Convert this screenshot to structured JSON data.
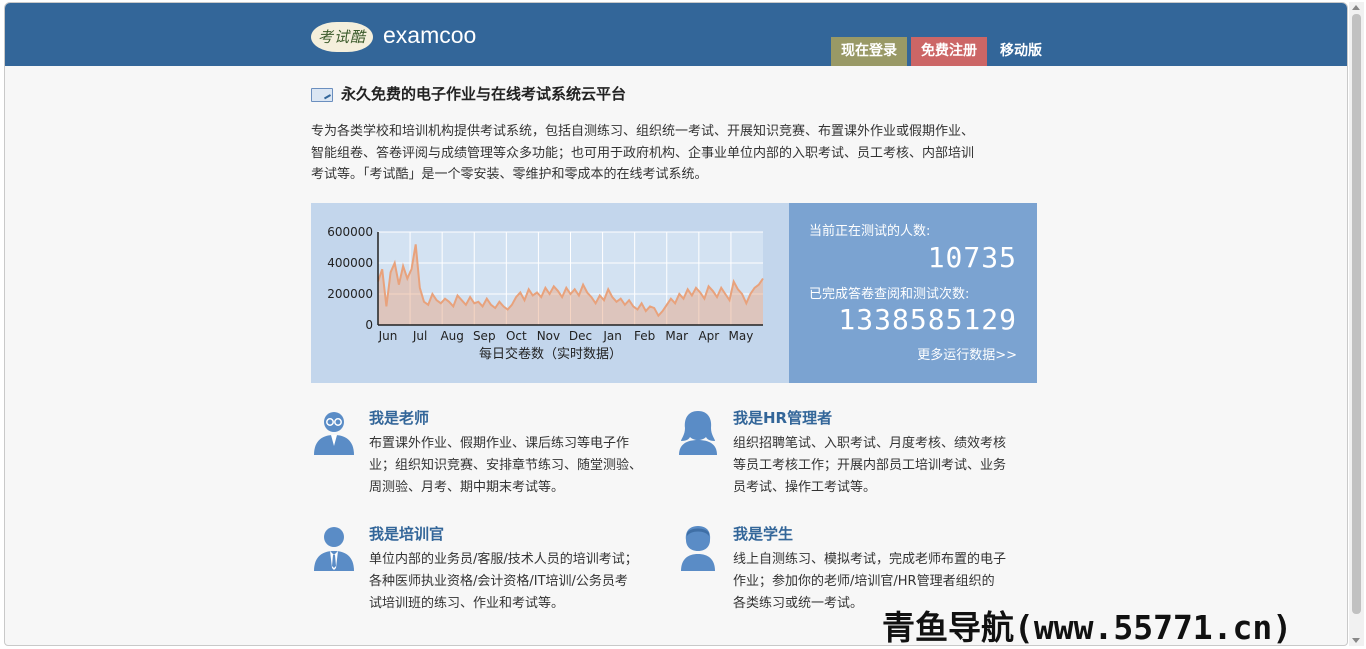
{
  "header": {
    "logo_badge": "考试酷",
    "logo_text": "examcoo",
    "nav": {
      "login": "现在登录",
      "register": "免费注册",
      "mobile": "移动版"
    },
    "colors": {
      "bar": "#336699",
      "login": "#999966",
      "register": "#cc6666"
    }
  },
  "page_title": "永久免费的电子作业与在线考试系统云平台",
  "intro_lines": [
    "专为各类学校和培训机构提供考试系统，包括自测练习、组织统一考试、开展知识竞赛、布置课外作业或假期作业、",
    "智能组卷、答卷评阅与成绩管理等众多功能；也可用于政府机构、企事业单位内部的入职考试、员工考核、内部培训",
    "考试等。「考试酷」是一个零安装、零维护和零成本的在线考试系统。"
  ],
  "stats": {
    "testing_label": "当前正在测试的人数:",
    "testing_value": "10735",
    "completed_label": "已完成答卷查阅和测试次数:",
    "completed_value": "1338585129",
    "more_link": "更多运行数据>>"
  },
  "chart_data": {
    "type": "area",
    "xlabel": "每日交卷数（实时数据）",
    "ylabel": "",
    "ylim": [
      0,
      600000
    ],
    "yticks": [
      "600000",
      "400000",
      "200000",
      "0"
    ],
    "categories": [
      "Jun",
      "Jul",
      "Aug",
      "Sep",
      "Oct",
      "Nov",
      "Dec",
      "Jan",
      "Feb",
      "Mar",
      "Apr",
      "May"
    ],
    "series": [
      {
        "values": [
          280000,
          360000,
          120000,
          340000,
          400000,
          260000,
          380000,
          300000,
          360000,
          520000,
          240000,
          150000,
          130000,
          200000,
          160000,
          140000,
          170000,
          150000,
          120000,
          190000,
          160000,
          130000,
          180000,
          140000,
          150000,
          120000,
          170000,
          130000,
          110000,
          150000,
          120000,
          100000,
          130000,
          180000,
          210000,
          160000,
          230000,
          190000,
          210000,
          180000,
          240000,
          200000,
          250000,
          220000,
          180000,
          240000,
          200000,
          230000,
          190000,
          260000,
          210000,
          180000,
          140000,
          190000,
          160000,
          230000,
          180000,
          150000,
          170000,
          130000,
          160000,
          120000,
          100000,
          140000,
          90000,
          120000,
          110000,
          60000,
          90000,
          130000,
          170000,
          140000,
          200000,
          170000,
          230000,
          190000,
          240000,
          210000,
          170000,
          250000,
          220000,
          180000,
          240000,
          200000,
          160000,
          280000,
          230000,
          200000,
          140000,
          200000,
          240000,
          260000,
          300000
        ],
        "color": "#e8a27c"
      }
    ],
    "grid": true
  },
  "roles": [
    {
      "title": "我是老师",
      "icon": "teacher-icon",
      "lines": [
        "布置课外作业、假期作业、课后练习等电子作",
        "业；组织知识竞赛、安排章节练习、随堂测验、",
        "周测验、月考、期中期末考试等。"
      ]
    },
    {
      "title": "我是HR管理者",
      "icon": "hr-manager-icon",
      "lines": [
        "组织招聘笔试、入职考试、月度考核、绩效考核",
        "等员工考核工作；开展内部员工培训考试、业务",
        "员考试、操作工考试等。"
      ]
    },
    {
      "title": "我是培训官",
      "icon": "trainer-icon",
      "lines": [
        "单位内部的业务员/客服/技术人员的培训考试；",
        "各种医师执业资格/会计资格/IT培训/公务员考",
        "试培训班的练习、作业和考试等。"
      ]
    },
    {
      "title": "我是学生",
      "icon": "student-icon",
      "lines": [
        "线上自测练习、模拟考试，完成老师布置的电子",
        "作业；参加你的老师/培训官/HR管理者组织的",
        "各类练习或统一考试。"
      ]
    }
  ],
  "watermark": "青鱼导航(www.55771.cn)"
}
